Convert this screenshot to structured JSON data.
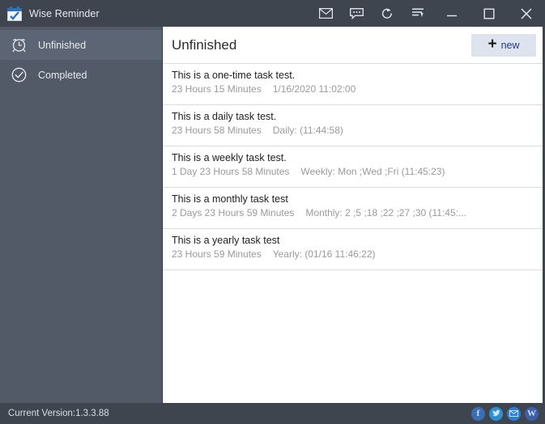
{
  "window": {
    "title": "Wise Reminder",
    "app_icon": "calendar-check-icon",
    "toolbar": [
      {
        "name": "mail-icon",
        "label": "Mail"
      },
      {
        "name": "feedback-icon",
        "label": "Feedback"
      },
      {
        "name": "refresh-icon",
        "label": "Check for updates"
      },
      {
        "name": "menu-list-icon",
        "label": "Menu"
      }
    ],
    "controls": {
      "minimize": "minimize-icon",
      "maximize": "maximize-icon",
      "close": "close-icon"
    }
  },
  "sidebar": {
    "items": [
      {
        "label": "Unfinished",
        "icon": "alarm-clock-icon",
        "active": true
      },
      {
        "label": "Completed",
        "icon": "check-circle-icon",
        "active": false
      }
    ]
  },
  "main": {
    "title": "Unfinished",
    "new_button": {
      "plus": "+",
      "label": "new"
    },
    "tasks": [
      {
        "title": "This is a one-time task test.",
        "remaining": "23 Hours  15 Minutes",
        "schedule": "1/16/2020 11:02:00"
      },
      {
        "title": "This is a daily task test.",
        "remaining": "23 Hours  58 Minutes",
        "schedule": "Daily: (11:44:58)"
      },
      {
        "title": "This is a weekly task test.",
        "remaining": "1 Day  23 Hours  58 Minutes",
        "schedule": "Weekly: Mon ;Wed ;Fri (11:45:23)"
      },
      {
        "title": "This is a monthly task test",
        "remaining": "2 Days  23 Hours  59 Minutes",
        "schedule": "Monthly: 2 ;5 ;18 ;22 ;27 ;30 (11:45:..."
      },
      {
        "title": "This is a yearly task test",
        "remaining": "23 Hours  59 Minutes",
        "schedule": "Yearly: (01/16 11:46:22)"
      }
    ]
  },
  "statusbar": {
    "version": "Current Version:1.3.3.88",
    "social": [
      {
        "name": "facebook-icon",
        "letter": "f"
      },
      {
        "name": "twitter-icon",
        "letter": ""
      },
      {
        "name": "email-icon",
        "letter": ""
      },
      {
        "name": "weibo-icon",
        "letter": "W"
      }
    ]
  },
  "colors": {
    "titlebar": "#3e454e",
    "sidebar": "#525a67",
    "sidebar_active": "#5c6573",
    "content_bg": "#ffffff",
    "accent_button": "#dde4ed",
    "accent_text": "#1f3b8c"
  }
}
